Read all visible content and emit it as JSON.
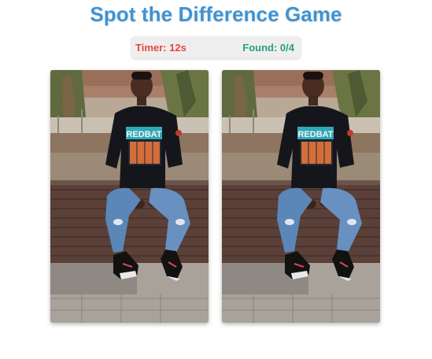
{
  "game": {
    "title": "Spot the Difference Game",
    "timer_text": "Timer: 12s",
    "found_text": "Found: 0/4",
    "timer_seconds": 12,
    "found_count": 0,
    "total_differences": 4
  },
  "images": {
    "shirt_text": "REDBAT",
    "left_alt": "original photo",
    "right_alt": "modified photo"
  },
  "colors": {
    "title": "#3e93d3",
    "timer": "#e7463f",
    "found": "#2a9d86"
  }
}
